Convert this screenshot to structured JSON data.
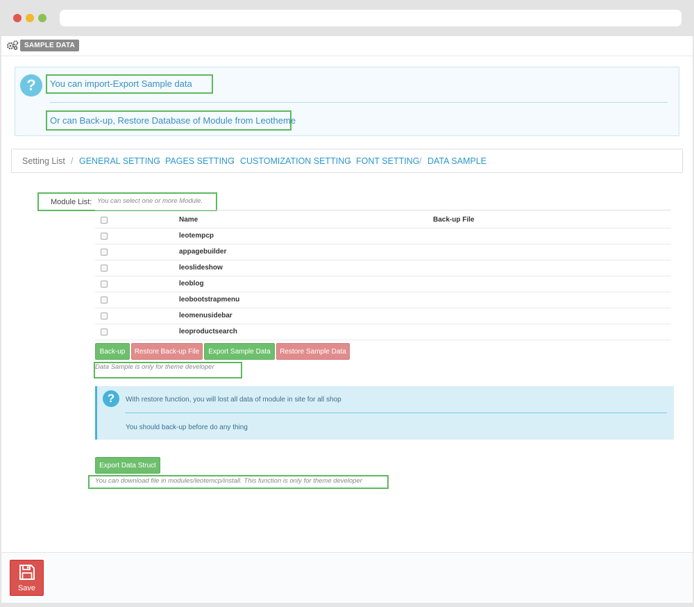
{
  "panel": {
    "title": "SAMPLE DATA"
  },
  "info": {
    "line1": "You can import-Export Sample data",
    "line2": "Or can Back-up, Restore Database of Module from Leotheme"
  },
  "breadcrumb": {
    "first": "Setting List",
    "links": [
      "GENERAL SETTING",
      "PAGES SETTING",
      "CUSTOMIZATION SETTING",
      "FONT SETTING",
      "DATA SAMPLE"
    ],
    "separator": "/"
  },
  "modules": {
    "label": "Module List:",
    "hint": "You can select one or more Module.",
    "headers": {
      "name": "Name",
      "backup": "Back-up File"
    },
    "rows": [
      "leotempcp",
      "appagebuilder",
      "leoslideshow",
      "leoblog",
      "leobootstrapmenu",
      "leomenusidebar",
      "leoproductsearch"
    ]
  },
  "actions": {
    "backup": "Back-up",
    "restore_backup": "Restore Back-up File",
    "export_sample": "Export Sample Data",
    "restore_sample": "Restore Sample Data",
    "dev_note": "Data Sample is only for theme developer"
  },
  "warning": {
    "line1": "With restore function, you will lost all data of module in site for all shop",
    "line2": "You should back-up before do any thing"
  },
  "export": {
    "button": "Export Data Struct",
    "note": "You can download file in modules/leotemcp/install. This function is only for theme developer"
  },
  "footer": {
    "save": "Save"
  },
  "colors": {
    "success": "#6dbf6d",
    "danger": "#e18c8c",
    "info": "#47b2d7",
    "link": "#2a97c9",
    "save": "#d9534f"
  }
}
